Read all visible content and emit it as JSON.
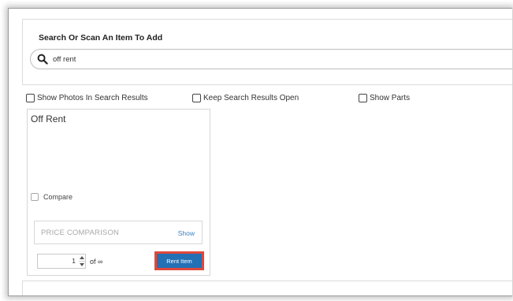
{
  "search": {
    "section_title": "Search Or Scan An Item To Add",
    "input_value": "off rent"
  },
  "options": [
    {
      "label": "Show Photos In Search Results",
      "checked": false
    },
    {
      "label": "Keep Search Results Open",
      "checked": false
    },
    {
      "label": "Show Parts",
      "checked": false
    }
  ],
  "result_card": {
    "title": "Off Rent",
    "compare_label": "Compare",
    "price_comparison_label": "PRICE COMPARISON",
    "price_show_link": "Show",
    "quantity_value": "1",
    "of_label": "of",
    "of_value": "∞",
    "rent_button_label": "Rent Item"
  },
  "colors": {
    "rent_button": "#2470b5",
    "highlight_outline": "#e0483a",
    "link": "#3a7fc1"
  }
}
